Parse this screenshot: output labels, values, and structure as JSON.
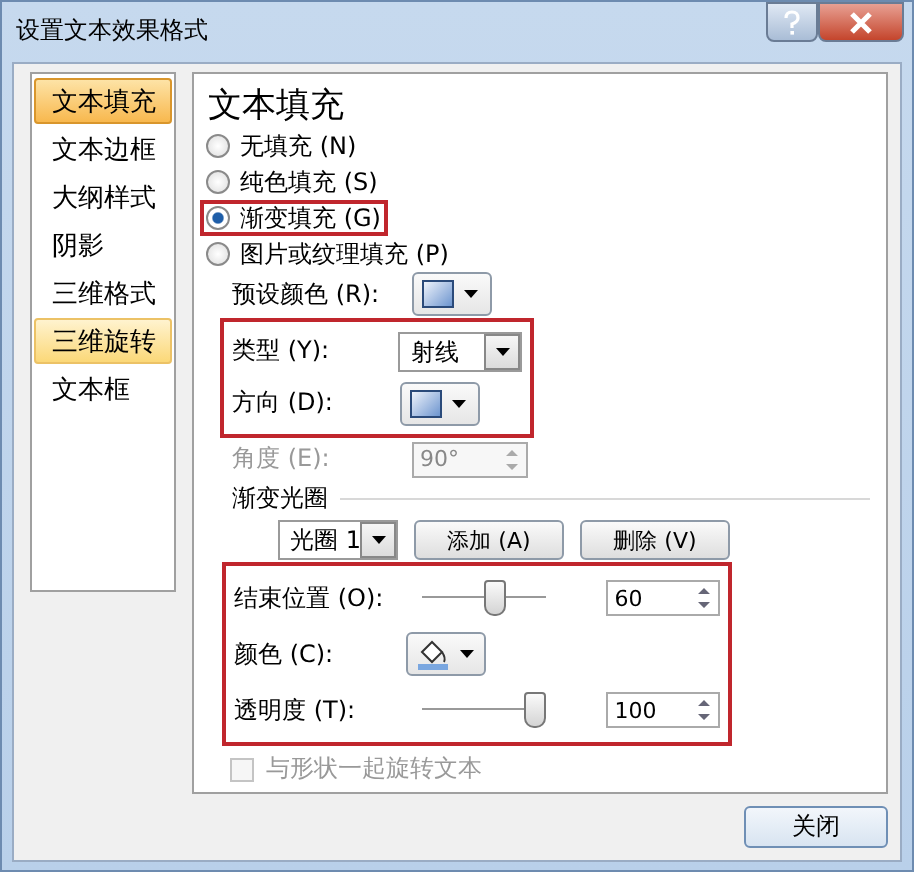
{
  "window": {
    "title": "设置文本效果格式"
  },
  "sidebar": {
    "items": [
      {
        "label": "文本填充",
        "selected": true,
        "hovered": false
      },
      {
        "label": "文本边框",
        "selected": false,
        "hovered": false
      },
      {
        "label": "大纲样式",
        "selected": false,
        "hovered": false
      },
      {
        "label": "阴影",
        "selected": false,
        "hovered": false
      },
      {
        "label": "三维格式",
        "selected": false,
        "hovered": false
      },
      {
        "label": "三维旋转",
        "selected": false,
        "hovered": true
      },
      {
        "label": "文本框",
        "selected": false,
        "hovered": false
      }
    ]
  },
  "panel": {
    "heading": "文本填充",
    "fill_options": [
      {
        "label": "无填充 (N)",
        "selected": false,
        "highlighted": false
      },
      {
        "label": "纯色填充 (S)",
        "selected": false,
        "highlighted": false
      },
      {
        "label": "渐变填充 (G)",
        "selected": true,
        "highlighted": true
      },
      {
        "label": "图片或纹理填充 (P)",
        "selected": false,
        "highlighted": false
      }
    ],
    "preset_color": {
      "label": "预设颜色 (R):"
    },
    "type_direction": {
      "highlighted": true,
      "type": {
        "label": "类型 (Y):",
        "value": "射线"
      },
      "direction": {
        "label": "方向 (D):"
      }
    },
    "angle": {
      "label": "角度 (E):",
      "value": "90°",
      "disabled": true
    },
    "gradient_stops": {
      "heading": "渐变光圈",
      "stop": "光圈 1",
      "buttons": [
        "添加 (A)",
        "删除 (V)"
      ]
    },
    "stop_settings": {
      "highlighted": true,
      "end_position": {
        "label": "结束位置 (O):",
        "level": 0.6,
        "value": "60"
      },
      "color": {
        "label": "颜色 (C):"
      },
      "transparency": {
        "label": "透明度 (T):",
        "level": 0.92,
        "value": "100"
      }
    },
    "rotate_with_shape": {
      "label": "与形状一起旋转文本",
      "checked": false,
      "disabled": true
    }
  },
  "close_button": "关闭"
}
